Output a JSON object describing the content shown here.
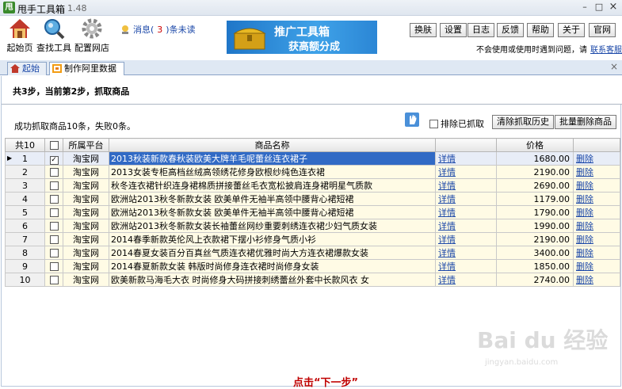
{
  "titlebar": {
    "icon_char": "甩",
    "title": "甩手工具箱",
    "version": "1.48",
    "minimize": "–",
    "maximize": "□",
    "close": "×"
  },
  "toolbar": {
    "home": "起始页",
    "find_tool": "查找工具",
    "config_shop": "配置网店"
  },
  "message": {
    "prefix": "消息(",
    "count": "3",
    "suffix": ")条未读"
  },
  "banner": {
    "line1": "推广工具箱",
    "line2": "获高额分成"
  },
  "top_buttons": [
    "换肤",
    "设置",
    "日志",
    "反馈",
    "帮助",
    "关于",
    "官网"
  ],
  "help_note": {
    "text": "不会使用或使用时遇到问题，请",
    "link": "联系客服"
  },
  "tabs": {
    "home": "起始页",
    "active": "制作阿里数据包",
    "close": "×"
  },
  "step": {
    "text": "共3步，当前第2步，抓取商品"
  },
  "result": {
    "text": "成功抓取商品10条，失败0条。"
  },
  "controls": {
    "exclude_label": "排除已抓取",
    "clear_history": "清除抓取历史",
    "batch_delete": "批量删除商品"
  },
  "grid": {
    "headers": {
      "count": "共10",
      "platform": "所属平台",
      "name": "商品名称",
      "price": "价格"
    },
    "detail_label": "详情",
    "delete_label": "删除",
    "rows": [
      {
        "idx": "1",
        "checked": true,
        "platform": "淘宝网",
        "name": "2013秋装新款春秋装欧美大牌羊毛呢蕾丝连衣裙子",
        "price": "1680.00"
      },
      {
        "idx": "2",
        "checked": false,
        "platform": "淘宝网",
        "name": "2013女装专柜高档丝绒高领绣花修身欧根纱纯色连衣裙",
        "price": "2190.00"
      },
      {
        "idx": "3",
        "checked": false,
        "platform": "淘宝网",
        "name": "秋冬连衣裙针织连身裙棉质拼接蕾丝毛衣宽松披肩连身裙明星气质款",
        "price": "2690.00"
      },
      {
        "idx": "4",
        "checked": false,
        "platform": "淘宝网",
        "name": "欧洲站2013秋冬新款女装 欧美单件无袖半高领中腰背心裙短裙",
        "price": "1179.00"
      },
      {
        "idx": "5",
        "checked": false,
        "platform": "淘宝网",
        "name": "欧洲站2013秋冬新款女装 欧美单件无袖半高领中腰背心裙短裙",
        "price": "1790.00"
      },
      {
        "idx": "6",
        "checked": false,
        "platform": "淘宝网",
        "name": "欧洲站2013秋冬新款女装长袖蕾丝网纱重要刺绣连衣裙少妇气质女装",
        "price": "1990.00"
      },
      {
        "idx": "7",
        "checked": false,
        "platform": "淘宝网",
        "name": "2014春季新款英伦风上衣款裙下摆小衫修身气质小衫",
        "price": "2190.00"
      },
      {
        "idx": "8",
        "checked": false,
        "platform": "淘宝网",
        "name": "2014春夏女装百分百真丝气质连衣裙优雅时尚大方连衣裙爆款女装",
        "price": "3400.00"
      },
      {
        "idx": "9",
        "checked": false,
        "platform": "淘宝网",
        "name": "2014春夏新款女装 韩版时尚修身连衣裙时尚修身女装",
        "price": "1850.00"
      },
      {
        "idx": "10",
        "checked": false,
        "platform": "淘宝网",
        "name": "欧美新款马海毛大衣 时尚修身大码拼接刺绣蕾丝外套中长款风衣 女",
        "price": "2740.00"
      }
    ]
  },
  "watermark": {
    "brand": "Bai du 经验",
    "url": "jingyan.baidu.com"
  },
  "next_hint": "点击“下一步”",
  "colors": {
    "selected_row": "#316ac5",
    "row_bg": "#fffbe5",
    "link": "#1a47a8",
    "hint_red": "#c00000"
  }
}
